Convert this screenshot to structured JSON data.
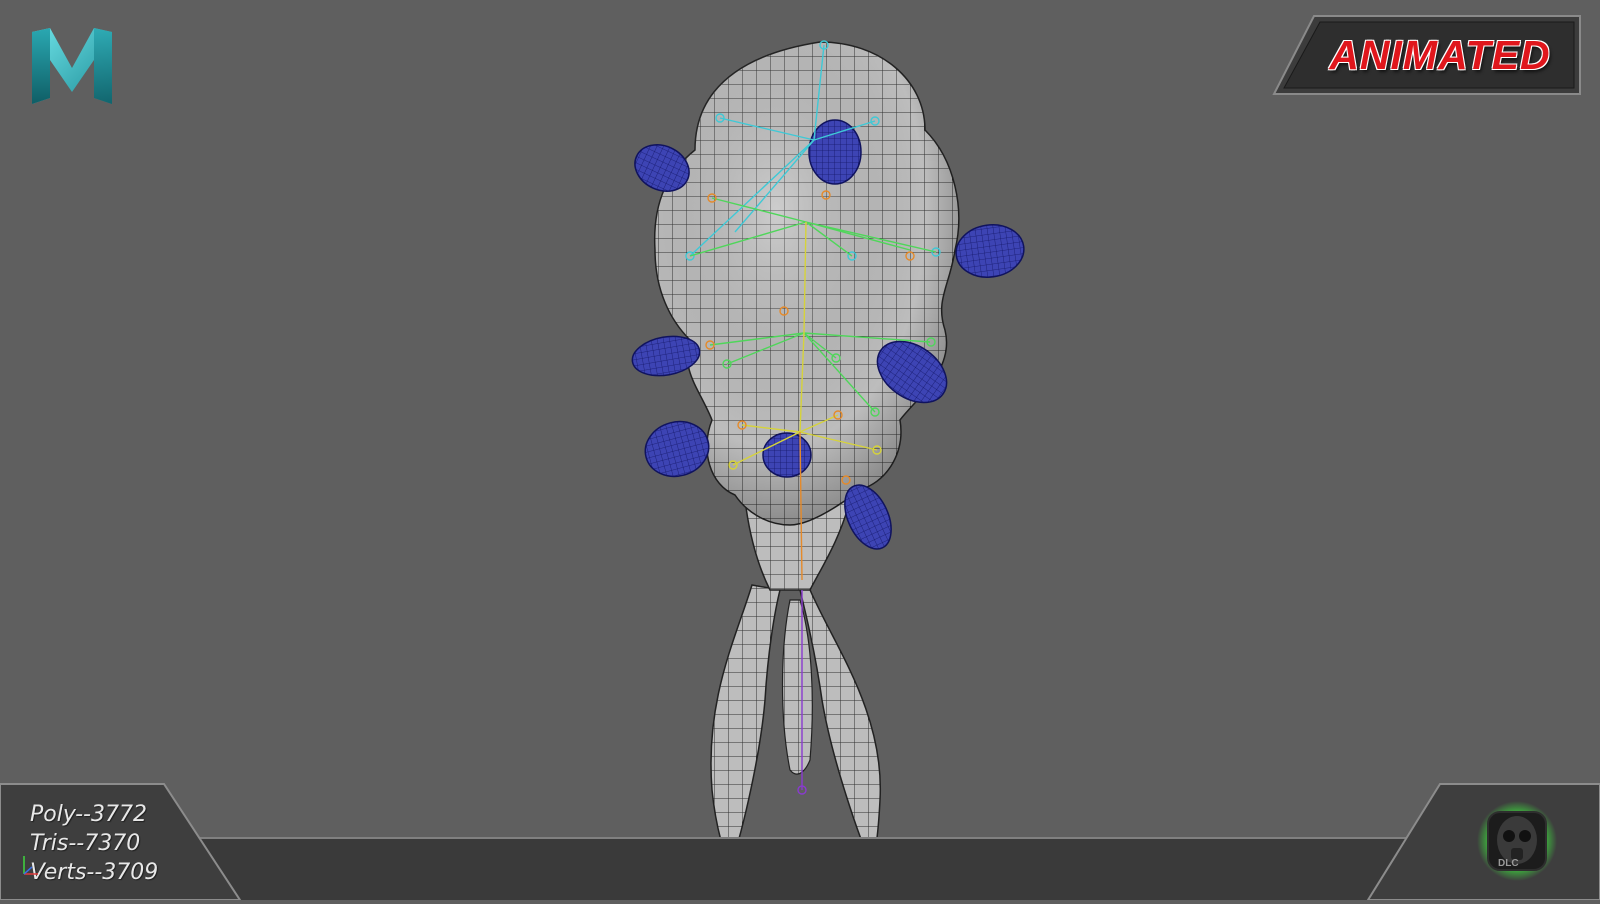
{
  "app": {
    "logo_icon": "maya-logo-icon"
  },
  "badge": {
    "label": "ANIMATED"
  },
  "stats": {
    "poly": "Poly--3772",
    "tris": "Tris--7370",
    "verts": "Verts--3709"
  },
  "colors": {
    "background": "#5f5f5f",
    "badge_text": "#e0161c",
    "mesh_fill": "#b9b9b9",
    "wire": "#2a2a2a",
    "pods": "#3a3fa8",
    "glow": "#3cff3c"
  }
}
